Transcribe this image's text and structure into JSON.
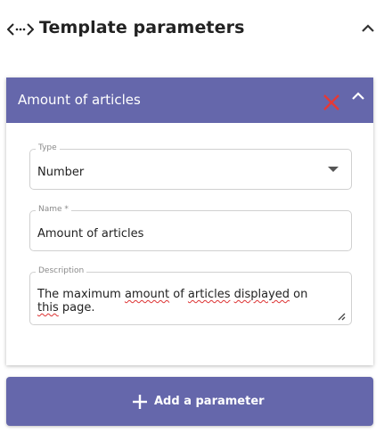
{
  "header": {
    "title": "Template parameters",
    "icon": "code-brackets-icon",
    "collapse_icon": "chevron-up-icon"
  },
  "parameter_card": {
    "title": "Amount of articles",
    "delete_icon": "close-icon",
    "collapse_icon": "chevron-up-icon",
    "header_color": "#6567ab",
    "delete_color": "#e53935",
    "type_field": {
      "label": "Type",
      "value": "Number"
    },
    "name_field": {
      "label": "Name *",
      "value": "Amount of articles"
    },
    "description_field": {
      "label": "Description",
      "value": "The maximum amount of articles displayed on this page.",
      "parts": [
        "The maximum ",
        "amount",
        " of ",
        "articles",
        " ",
        "displayed",
        " on ",
        "this",
        " page."
      ]
    }
  },
  "add_button": {
    "label": "Add a parameter",
    "icon": "plus-icon",
    "color": "#6567ab"
  }
}
